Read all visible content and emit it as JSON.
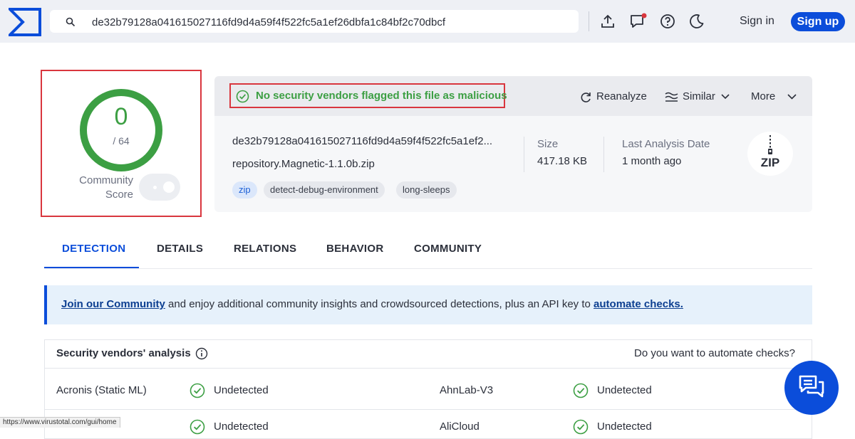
{
  "colors": {
    "brand_blue": "#0b4dda",
    "clean_green": "#3c9f43",
    "highlight_red": "#d9363e",
    "banner_bg": "#e6f1fb"
  },
  "header": {
    "search_value": "de32b79128a041615027116fd9d4a59f4f522fc5a1ef26dbfa1c84bf2c70dbcf",
    "icons": [
      "virustotal-logo-icon",
      "search-icon",
      "upload-icon",
      "chat-notification-icon",
      "help-icon",
      "dark-mode-icon"
    ],
    "sign_in": "Sign in",
    "sign_up": "Sign up"
  },
  "score": {
    "detections": "0",
    "total": "/ 64",
    "community_label_1": "Community",
    "community_label_2": "Score"
  },
  "verdict": {
    "text": "No security vendors flagged this file as malicious"
  },
  "actions": {
    "reanalyze": "Reanalyze",
    "similar": "Similar",
    "more": "More"
  },
  "file": {
    "hash_truncated": "de32b79128a041615027116fd9d4a59f4f522fc5a1ef2...",
    "name": "repository.Magnetic-1.1.0b.zip",
    "tags": [
      "zip",
      "detect-debug-environment",
      "long-sleeps"
    ],
    "size_label": "Size",
    "size_value": "417.18 KB",
    "date_label": "Last Analysis Date",
    "date_value": "1 month ago",
    "type_badge": "ZIP"
  },
  "tabs": [
    "DETECTION",
    "DETAILS",
    "RELATIONS",
    "BEHAVIOR",
    "COMMUNITY"
  ],
  "banner": {
    "link1": "Join our Community",
    "middle": " and enjoy additional community insights and crowdsourced detections, plus an API key to ",
    "link2": "automate checks."
  },
  "vendors": {
    "title": "Security vendors' analysis",
    "cta": "Do you want to automate checks?",
    "rows": [
      {
        "left_name": "Acronis (Static ML)",
        "left_result": "Undetected",
        "right_name": "AhnLab-V3",
        "right_result": "Undetected"
      },
      {
        "left_name": "",
        "left_result": "Undetected",
        "right_name": "AliCloud",
        "right_result": "Undetected"
      }
    ]
  },
  "status_url": "https://www.virustotal.com/gui/home"
}
